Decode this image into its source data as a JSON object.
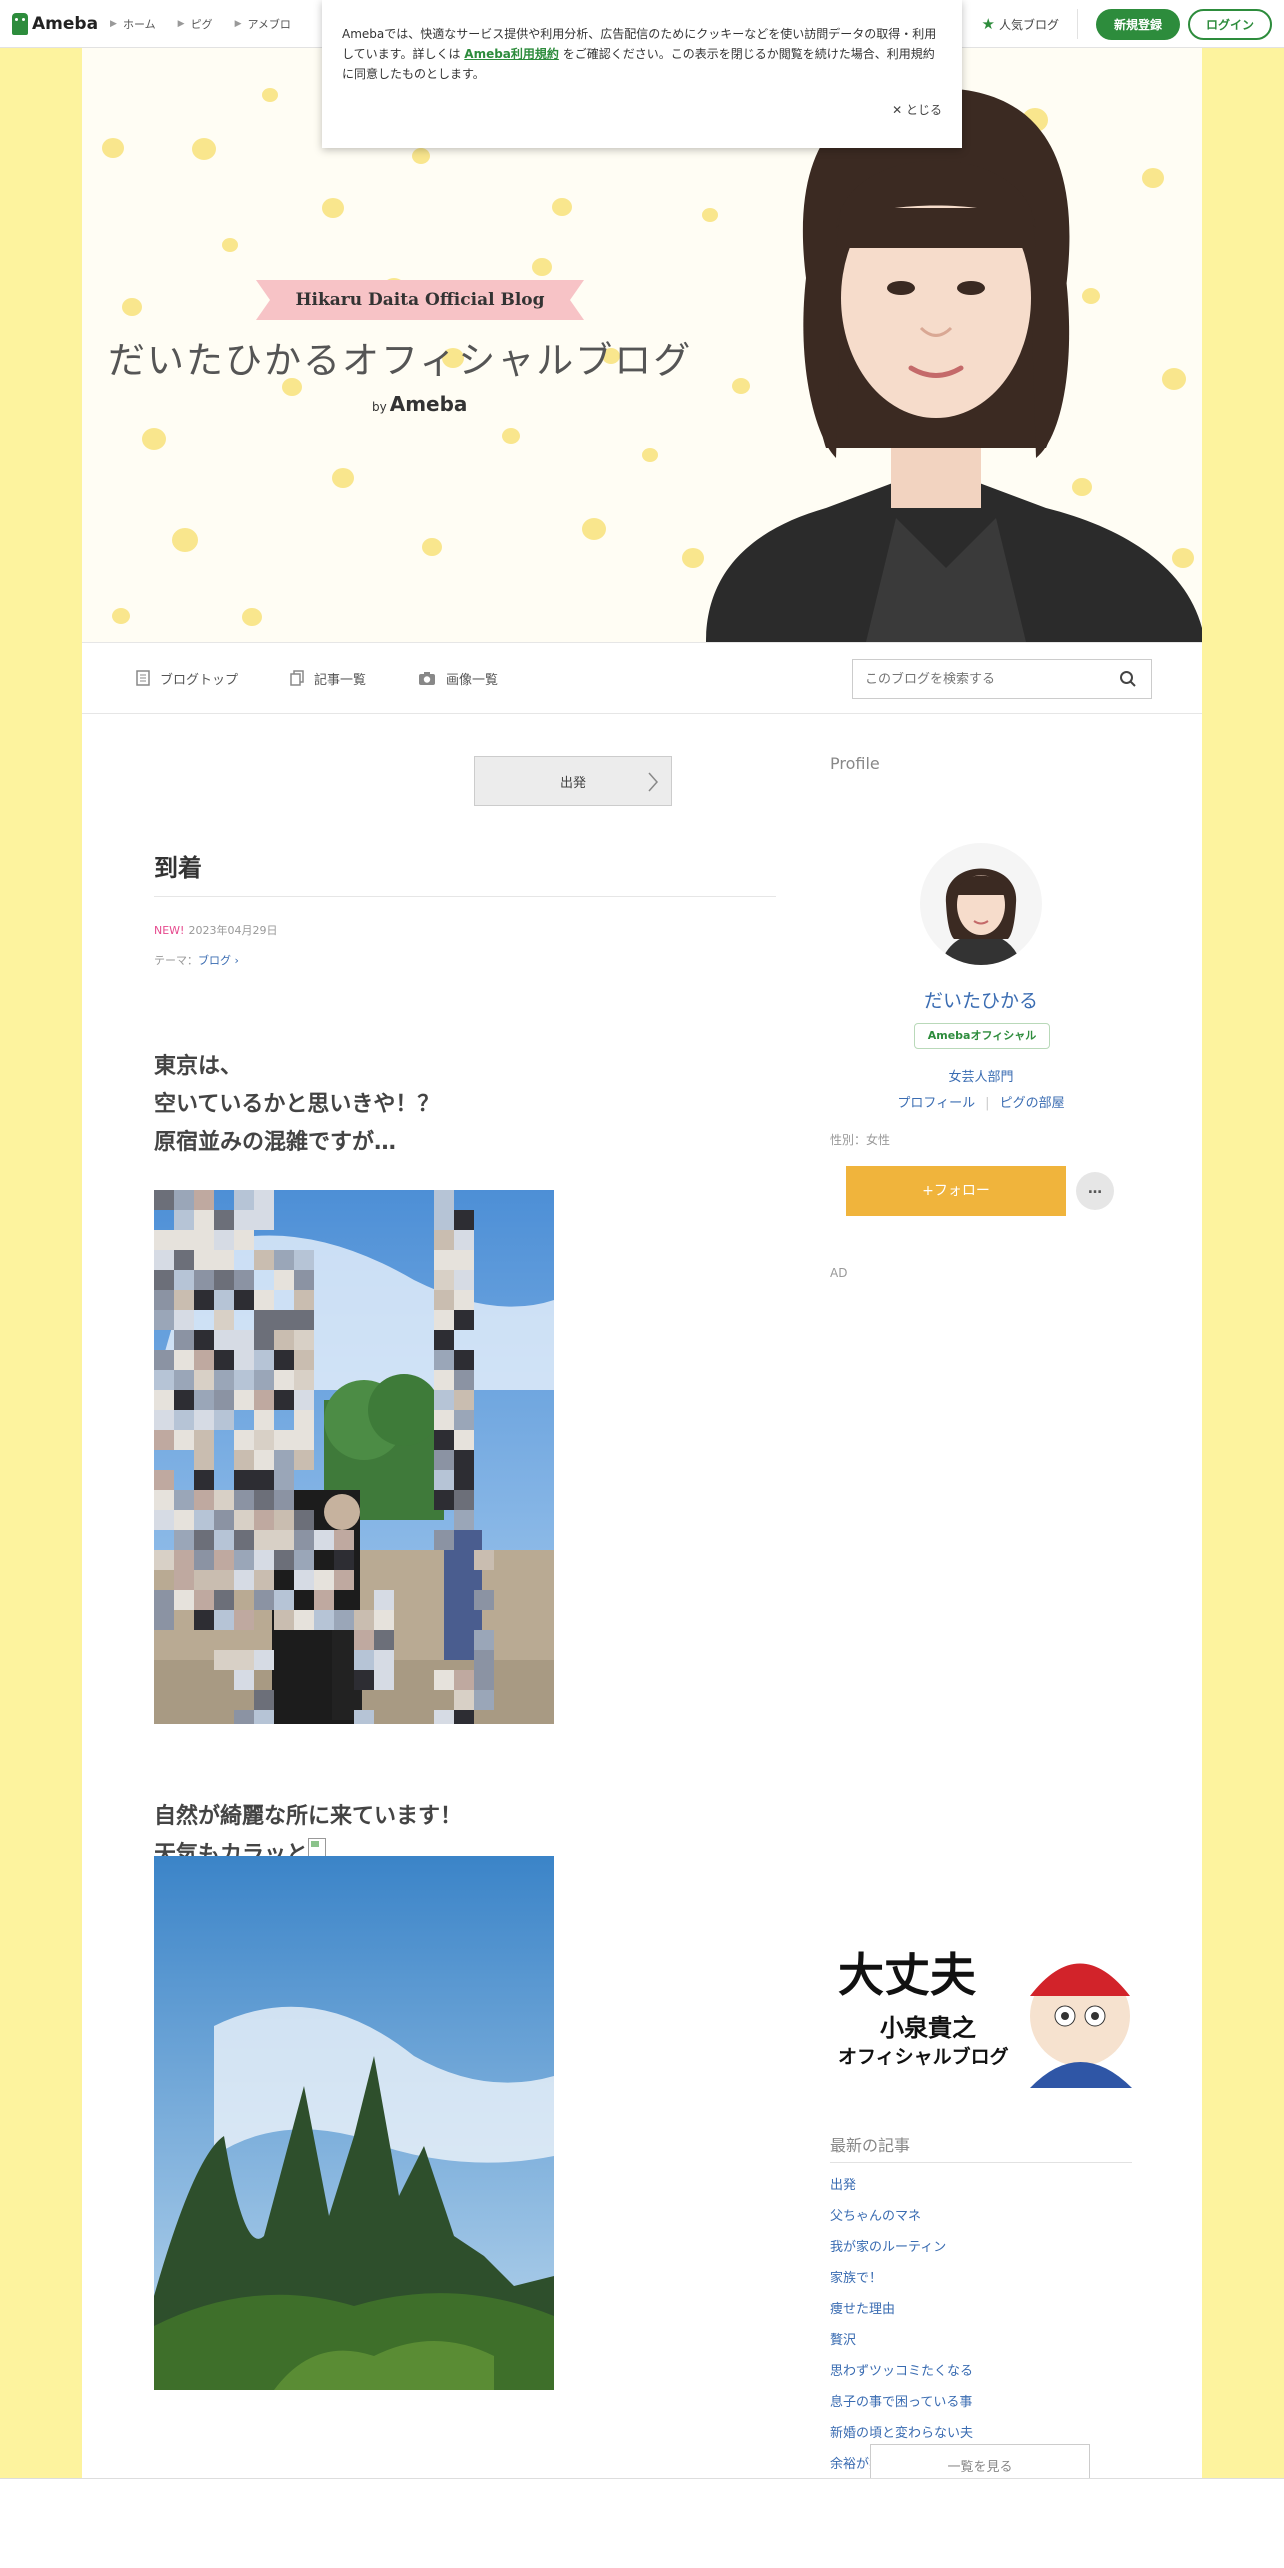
{
  "topbar": {
    "logo": "Ameba",
    "nav": [
      "ホーム",
      "ピグ",
      "アメブロ"
    ],
    "popular": "人気ブログ",
    "register": "新規登録",
    "login": "ログイン"
  },
  "cookie": {
    "text_before": "Amebaでは、快適なサービス提供や利用分析、広告配信のためにクッキーなどを使い訪問データの取得・利用しています。詳しくは",
    "link": "Ameba利用規約",
    "text_after": "をご確認ください。この表示を閉じるか閲覧を続けた場合、利用規約に同意したものとします。",
    "close": "とじる"
  },
  "header": {
    "ribbon": "Hikaru Daita Official Blog",
    "title": "だいたひかるオフィシャルブログ",
    "by": "by",
    "brand": "Ameba"
  },
  "blognav": {
    "items": [
      "ブログトップ",
      "記事一覧",
      "画像一覧"
    ],
    "search_placeholder": "このブログを検索する"
  },
  "article": {
    "prev_label": "出発",
    "title": "到着",
    "new_badge": "NEW!",
    "date": "2023年04月29日",
    "theme_label": "テーマ：",
    "theme": "ブログ",
    "para1": [
      "東京は、",
      "空いているかと思いきや！？",
      "原宿並みの混雑ですが…"
    ],
    "para2": [
      "自然が綺麗な所に来ています！",
      "天気もカラッと"
    ]
  },
  "sidebar": {
    "profile_head": "Profile",
    "name": "だいたひかる",
    "badge": "Amebaオフィシャル",
    "category": "女芸人部門",
    "links": [
      "プロフィール",
      "ピグの部屋"
    ],
    "gender": "性別：女性",
    "follow": "+フォロー",
    "more": "…",
    "ad": "AD",
    "ad_banner": {
      "line1": "大丈夫",
      "line2": "小泉貴之",
      "line3": "オフィシャルブログ"
    },
    "latest_head": "最新の記事",
    "latest": [
      "出発",
      "父ちゃんのマネ",
      "我が家のルーティン",
      "家族で！",
      "痩せた理由",
      "贅沢",
      "思わずツッコミたくなる",
      "息子の事で困っている事",
      "新婚の頃と変わらない夫",
      "余裕が無くて…"
    ],
    "see_all": "一覧を見る"
  },
  "colors": {
    "brand_green": "#2d8c3c",
    "page_bg": "#fdf39e",
    "link_blue": "#3a6cb2",
    "follow_orange": "#f0b43c",
    "ribbon_pink": "#f7c3c6"
  }
}
